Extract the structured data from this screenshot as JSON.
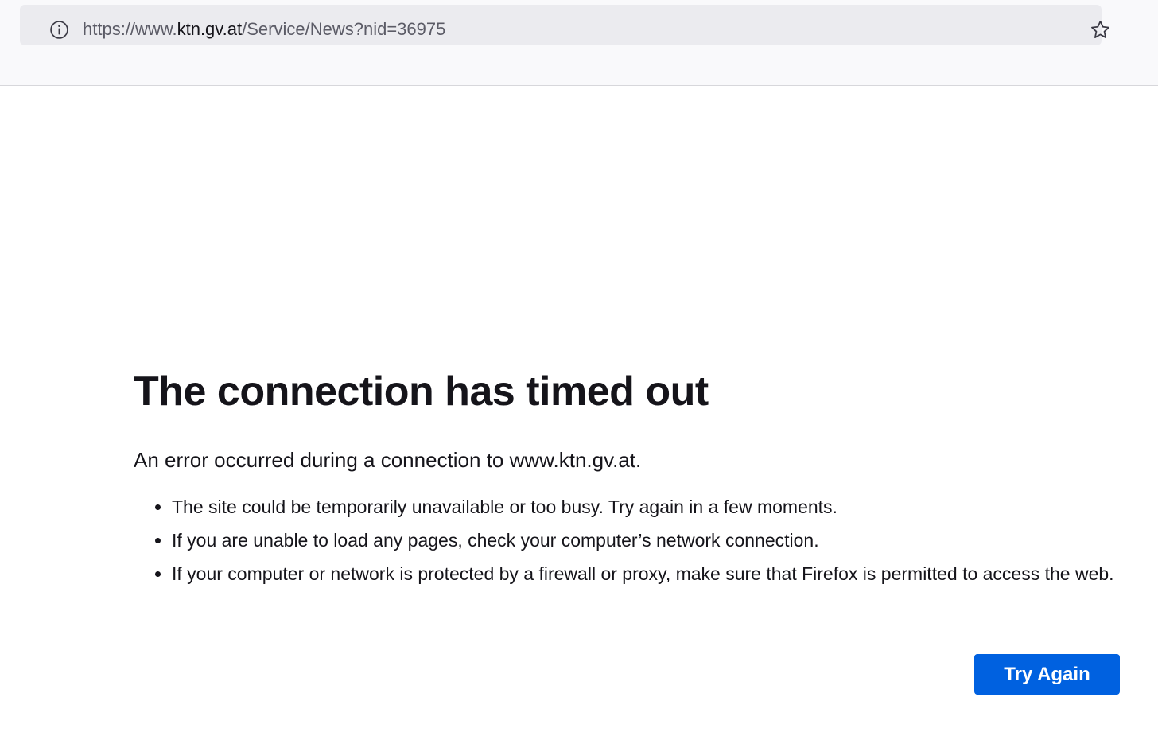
{
  "browser": {
    "url_prefix": "https://www.",
    "url_domain": "ktn.gv.at",
    "url_path": "/Service/News?nid=36975",
    "info_icon": "info-icon",
    "bookmark_icon": "star-icon"
  },
  "error_page": {
    "title": "The connection has timed out",
    "description": "An error occurred during a connection to www.ktn.gv.at.",
    "suggestions": [
      "The site could be temporarily unavailable or too busy. Try again in a few moments.",
      "If you are unable to load any pages, check your computer’s network connection.",
      "If your computer or network is protected by a firewall or proxy, make sure that Firefox is permitted to access the web."
    ],
    "try_again_label": "Try Again"
  },
  "colors": {
    "accent": "#0061e0",
    "toolbar_bg": "#f9f9fb",
    "urlbar_bg": "#ebebef",
    "text": "#15141a"
  }
}
